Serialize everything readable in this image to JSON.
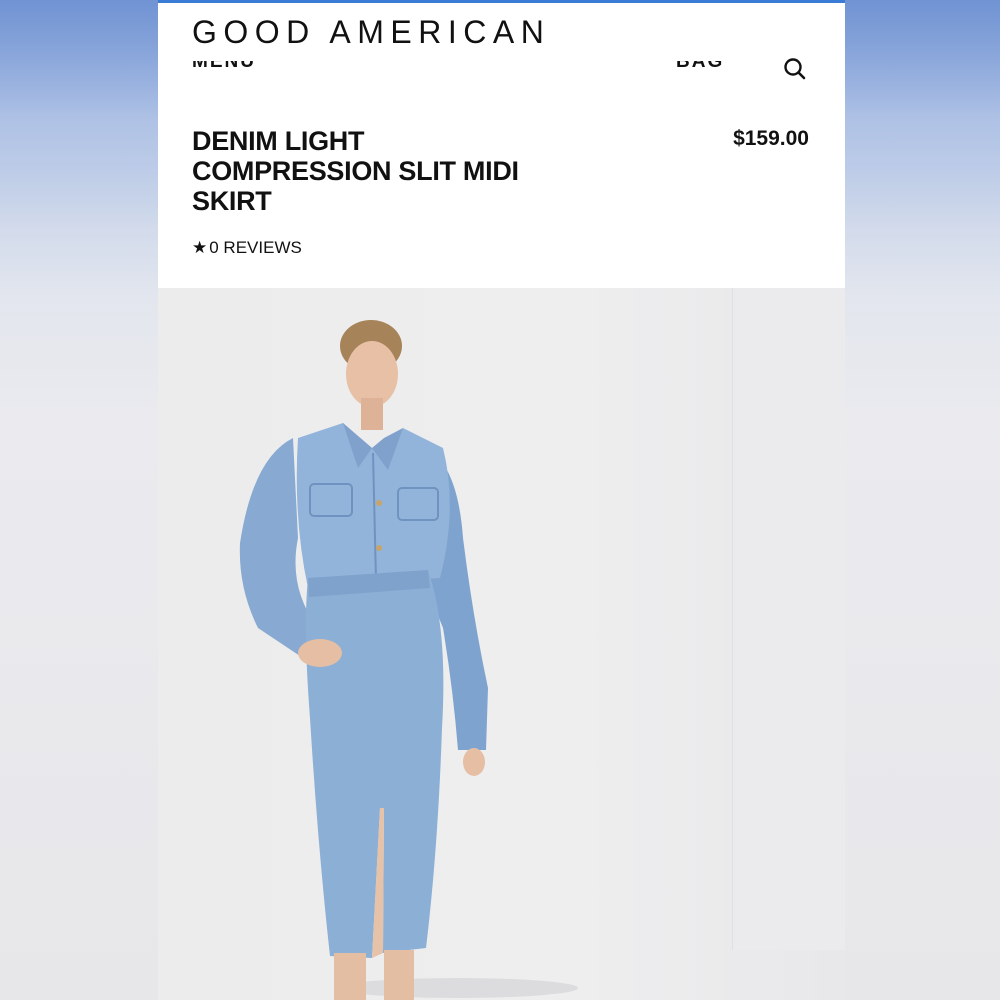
{
  "brand": "GOOD AMERICAN",
  "nav": {
    "menu_label": "MENU",
    "bag_label": "BAG",
    "search_icon": "search-icon"
  },
  "product": {
    "title": "DENIM LIGHT COMPRESSION SLIT MIDI SKIRT",
    "price": "$159.00",
    "reviews_label": "0 REVIEWS",
    "rating_icon": "star-icon"
  },
  "colors": {
    "page_background": "#e8e8ec",
    "top_gradient": "#7f9fd8",
    "denim": "#8fb0d6",
    "text": "#111111"
  }
}
